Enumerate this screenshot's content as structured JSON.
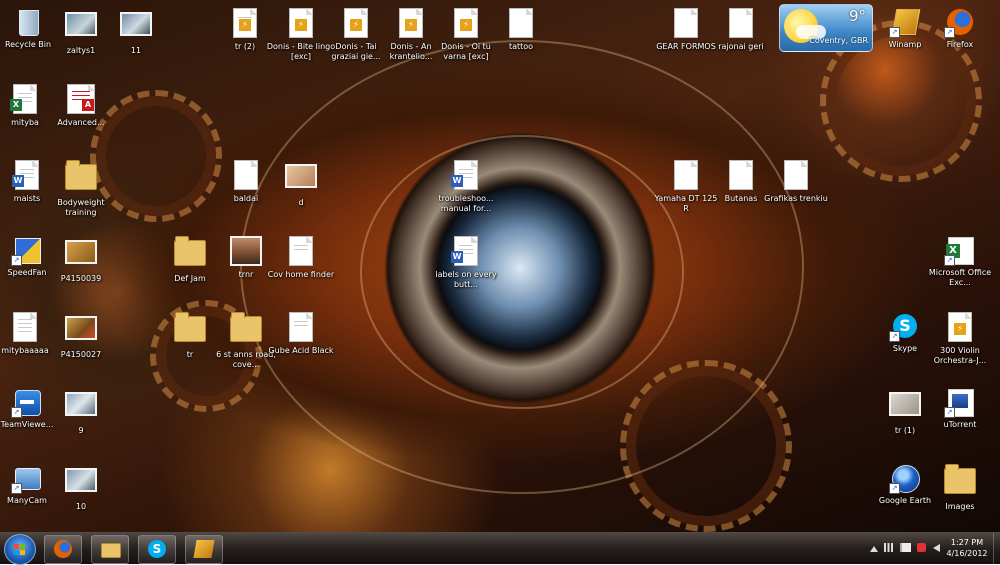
{
  "desktop": {
    "icons": [
      {
        "label": "Recycle Bin"
      },
      {
        "label": "zaltys1"
      },
      {
        "label": "11"
      },
      {
        "label": "tr (2)"
      },
      {
        "label": "Donis - Bite lingo [exc]"
      },
      {
        "label": "Donis - Tai graziai gie..."
      },
      {
        "label": "Donis - An krantelio..."
      },
      {
        "label": "Donis - Oi tu varna [exc]"
      },
      {
        "label": "tattoo"
      },
      {
        "label": "GEAR FORMOS"
      },
      {
        "label": "rajonai geri"
      },
      {
        "label": "Winamp"
      },
      {
        "label": "Firefox"
      },
      {
        "label": "mityba"
      },
      {
        "label": "Advanced..."
      },
      {
        "label": "maists"
      },
      {
        "label": "Bodyweight training"
      },
      {
        "label": "baldai"
      },
      {
        "label": "d"
      },
      {
        "label": "troubleshoo... manual for..."
      },
      {
        "label": "Yamaha DT 125 R"
      },
      {
        "label": "Butanas"
      },
      {
        "label": "Grafikas trenkiu"
      },
      {
        "label": "SpeedFan"
      },
      {
        "label": "P4150039"
      },
      {
        "label": "Def Jam"
      },
      {
        "label": "trnr"
      },
      {
        "label": "Cov home finder"
      },
      {
        "label": "labels on every butt..."
      },
      {
        "label": "Microsoft Office Exc..."
      },
      {
        "label": "mitybaaaaa"
      },
      {
        "label": "P4150027"
      },
      {
        "label": "tr"
      },
      {
        "label": "6 st anns road, cove..."
      },
      {
        "label": "Gube Acid Black"
      },
      {
        "label": "Skype"
      },
      {
        "label": "300 Violin Orchestra-J..."
      },
      {
        "label": "TeamViewe..."
      },
      {
        "label": "9"
      },
      {
        "label": "tr (1)"
      },
      {
        "label": "uTorrent"
      },
      {
        "label": "ManyCam"
      },
      {
        "label": "10"
      },
      {
        "label": "Google Earth"
      },
      {
        "label": "Images"
      }
    ]
  },
  "weather": {
    "temperature": "9°",
    "location": "Coventry, GBR"
  },
  "taskbar": {
    "pinned": [
      {
        "icon": "firefox-icon"
      },
      {
        "icon": "explorer-folder-icon"
      },
      {
        "icon": "skype-icon"
      },
      {
        "icon": "winamp-icon"
      }
    ],
    "clock": {
      "time": "1:27 PM",
      "date": "4/16/2012"
    }
  },
  "colors": {
    "folder": "#e9c46a",
    "word_blue": "#2b5fb8",
    "excel_green": "#1f7a3a",
    "pdf_red": "#c8191e",
    "skype_blue": "#00aff0",
    "firefox_orange": "#e66000"
  }
}
